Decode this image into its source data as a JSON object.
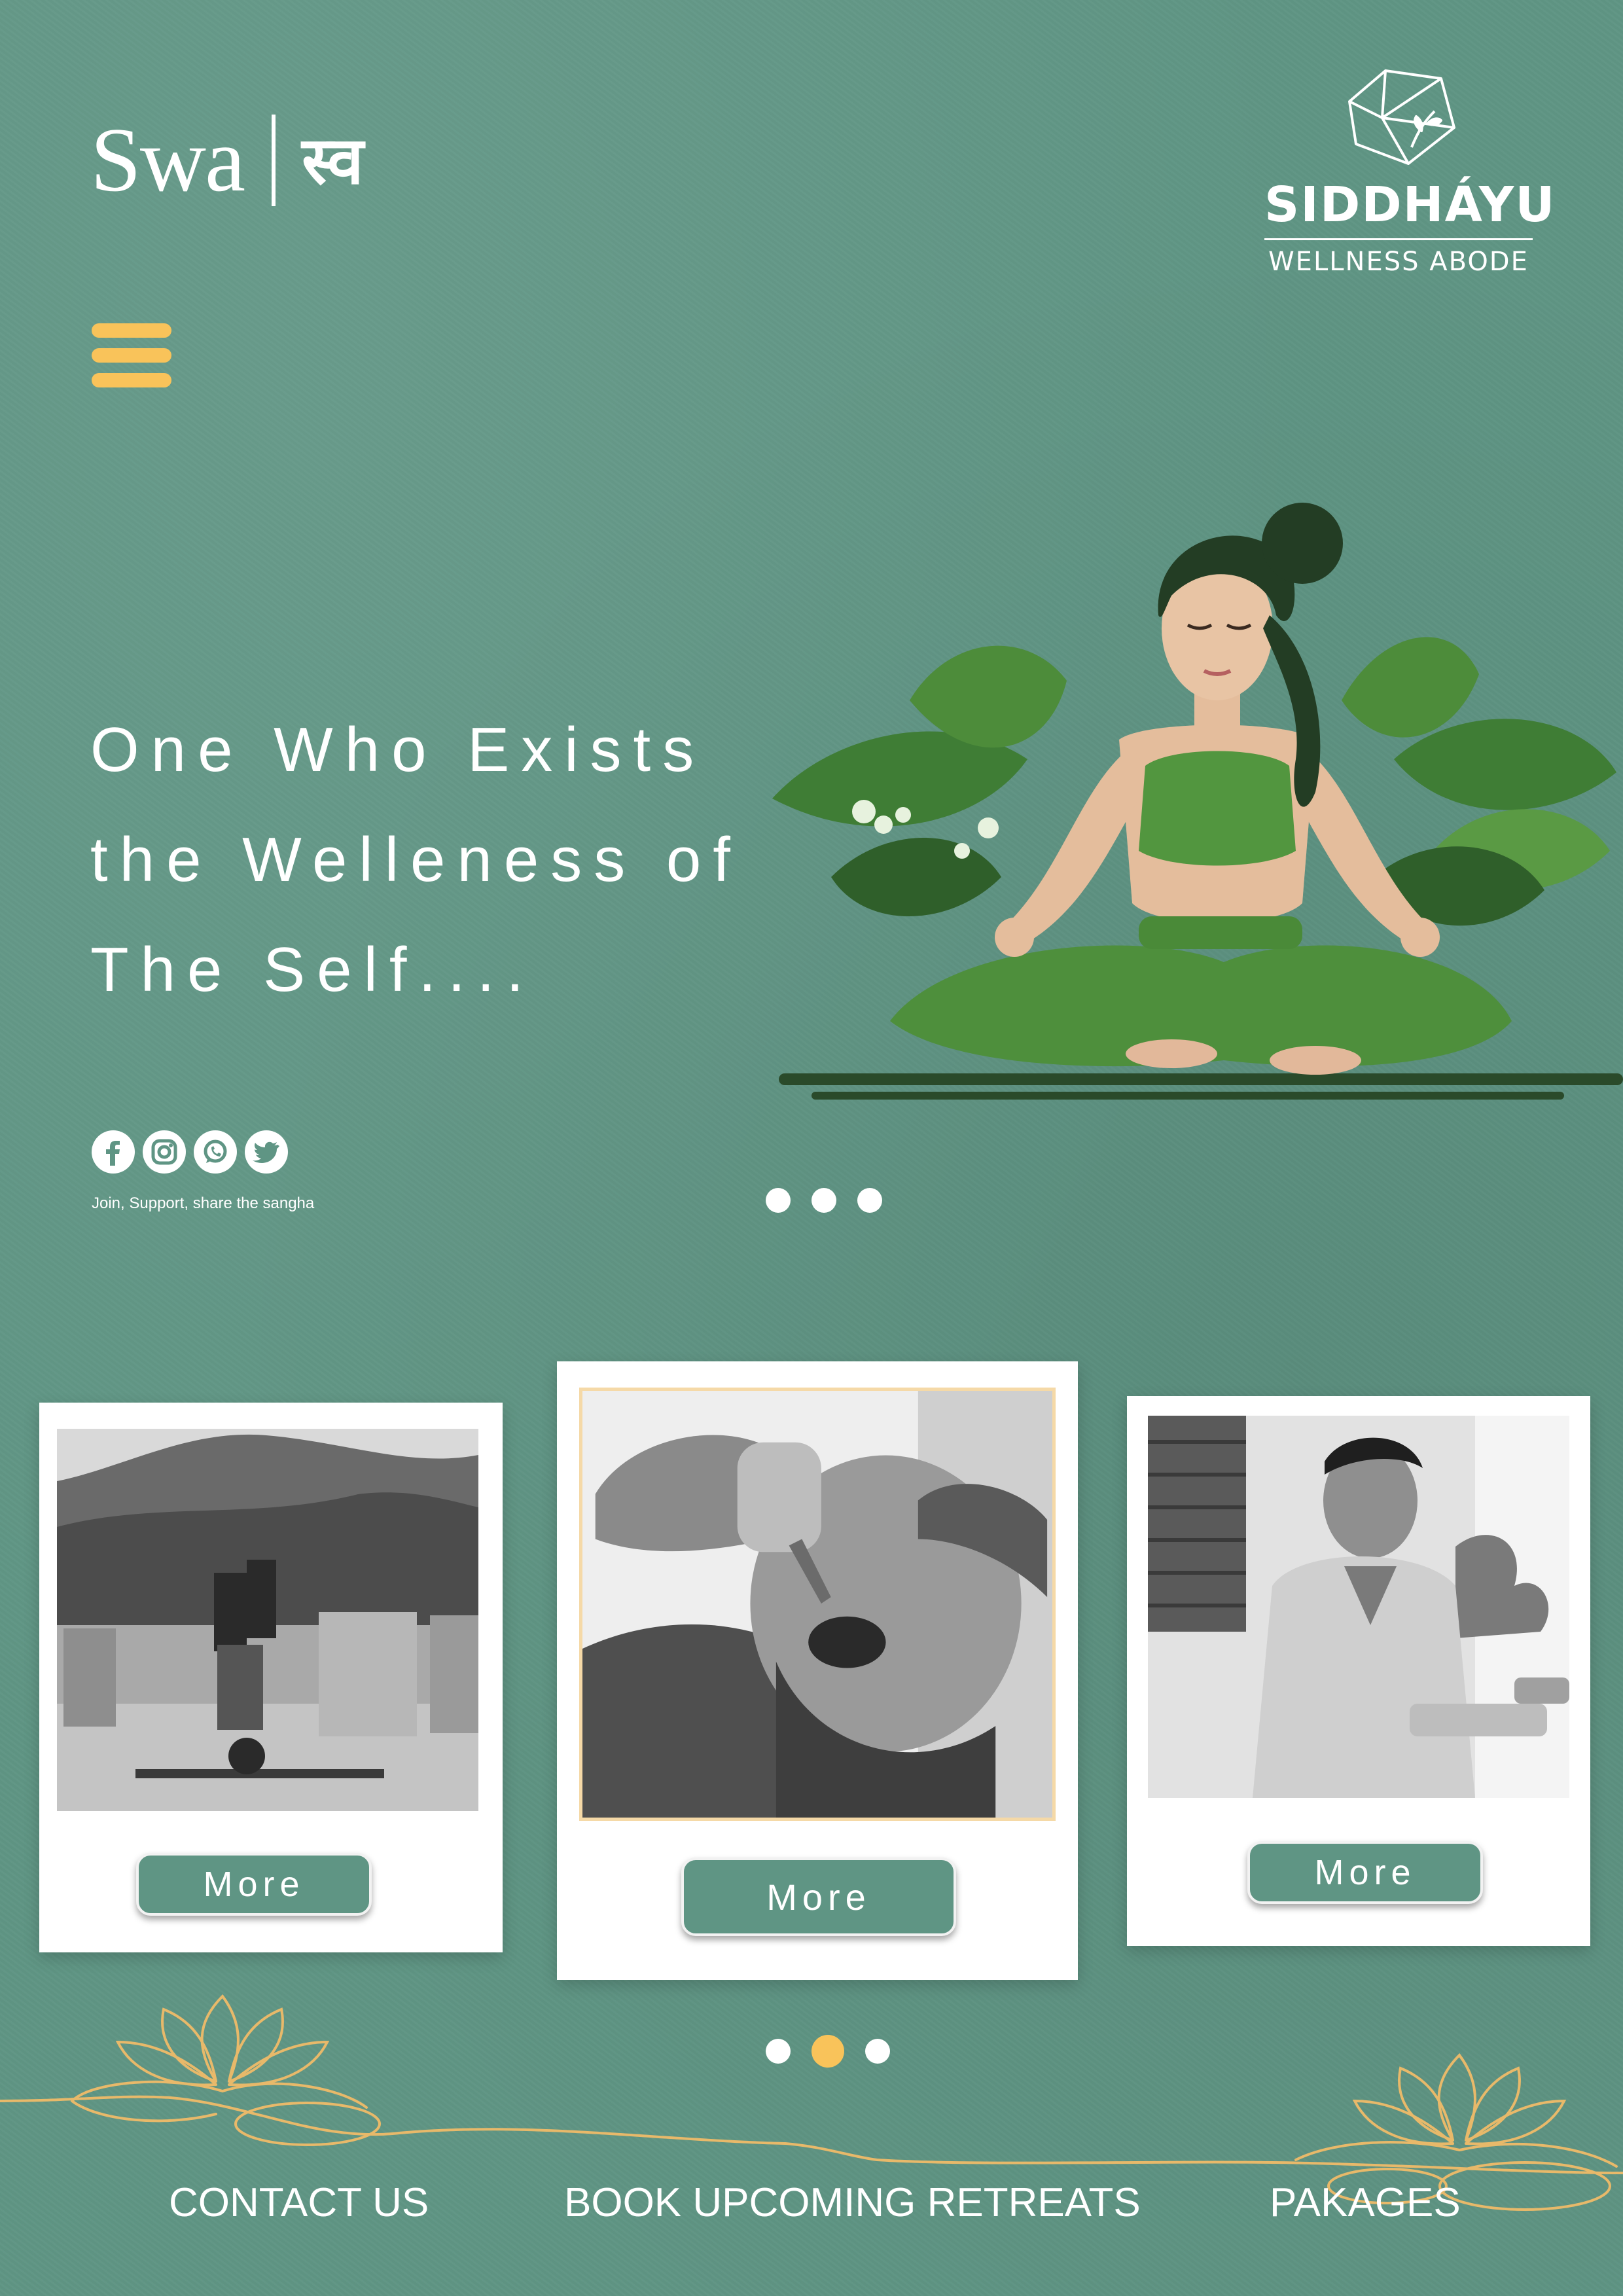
{
  "brand": {
    "latin": "Swa",
    "devanagari": "स्व"
  },
  "logo": {
    "name": "SIDDHÁYU",
    "tagline": "WELLNESS ABODE"
  },
  "colors": {
    "background": "#5f9584",
    "accent": "#f9c35a",
    "white": "#ffffff"
  },
  "hero": {
    "title_lines": [
      "One Who Exists",
      "the Welleness of",
      "The Self...."
    ],
    "illustration": "meditating-woman-with-leaves"
  },
  "social": {
    "icons": [
      "facebook-icon",
      "instagram-icon",
      "whatsapp-icon",
      "twitter-icon"
    ],
    "caption": "Join, Support, share the sangha"
  },
  "carousel_top": {
    "count": 3,
    "active_index": null
  },
  "cards": [
    {
      "photo": "headstand-yoga-terrace",
      "button": "More"
    },
    {
      "photo": "neti-nasal-cleansing",
      "button": "More"
    },
    {
      "photo": "ayurvedic-pulse-consultation",
      "button": "More"
    }
  ],
  "carousel_bottom": {
    "count": 3,
    "active_index": 1
  },
  "footer": {
    "links": [
      "CONTACT US",
      "BOOK UPCOMING RETREATS",
      "PAKAGES"
    ]
  }
}
